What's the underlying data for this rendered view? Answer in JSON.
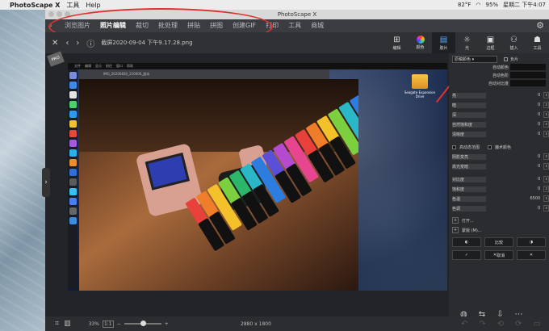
{
  "menubar": {
    "app_name": "PhotoScape X",
    "items": [
      "工具",
      "Help"
    ],
    "status": {
      "battery": "82°F",
      "wifi_pct": "95%",
      "datetime": "星期二 下午4:07"
    }
  },
  "window": {
    "title": "PhotoScape X"
  },
  "tabs": [
    "浏览图片",
    "照片编辑",
    "裁切",
    "批处理",
    "拼贴",
    "拼图",
    "创建GIF",
    "打印",
    "工具",
    "商城"
  ],
  "active_tab": "照片编辑",
  "file": {
    "name": "截屏2020-09-04 下午9.17.28.png"
  },
  "tools": [
    {
      "icon": "edit-icon",
      "label": "编辑"
    },
    {
      "icon": "color-wheel-icon",
      "label": "颜色"
    },
    {
      "icon": "film-icon",
      "label": "胶片"
    },
    {
      "icon": "light-icon",
      "label": "光"
    },
    {
      "icon": "frame-icon",
      "label": "边框"
    },
    {
      "icon": "insert-icon",
      "label": "插入"
    },
    {
      "icon": "tools-icon",
      "label": "工具"
    }
  ],
  "screenshot_content": {
    "inner_menubar": [
      "文件",
      "编辑",
      "显示",
      "前往",
      "窗口",
      "帮助"
    ],
    "inner_title": "IMG_20200830_210006_副本",
    "drive_label": "Seagate Expansion Drive"
  },
  "panel": {
    "preset": "原稿颜色",
    "negative_label": "负片",
    "auto_rows": [
      "自动颜色",
      "自动色阶",
      "自动对比度"
    ],
    "sliders": [
      {
        "label": "亮",
        "value": "0"
      },
      {
        "label": "暗",
        "value": "0"
      },
      {
        "label": "深",
        "value": "0"
      },
      {
        "label": "自然饱和度",
        "value": "0"
      },
      {
        "label": "清晰度",
        "value": "0"
      }
    ],
    "section2": {
      "left": "高动态范围",
      "right": "魔术颜色"
    },
    "sliders2": [
      {
        "label": "阴影变亮",
        "value": "0"
      },
      {
        "label": "高光变暗",
        "value": "0"
      },
      {
        "label": "对比度",
        "value": "0"
      },
      {
        "label": "饱和度",
        "value": "0"
      },
      {
        "label": "色温",
        "value": "6500"
      },
      {
        "label": "色调",
        "value": "0"
      }
    ],
    "open_label": "打开...",
    "mask_label": "蒙版 (M)...",
    "buttons": [
      {
        "icon": "undo-icon",
        "label": "取消"
      },
      {
        "icon": "compare-icon",
        "label": "比较"
      },
      {
        "icon": "ok-icon",
        "label": "取消"
      },
      {
        "icon": "cancel-icon",
        "label": "取消"
      }
    ],
    "btn_cancel": "取消",
    "btn_compare": "比较",
    "btn_x_cancel": "取消"
  },
  "status": {
    "zoom": "33%",
    "fit": "1:1",
    "dimensions": "2880 x 1800"
  }
}
